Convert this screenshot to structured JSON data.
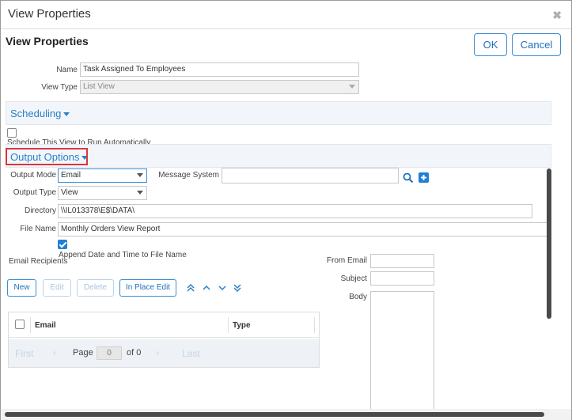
{
  "window": {
    "title": "View Properties",
    "close_glyph": "✖"
  },
  "heading": "View Properties",
  "buttons": {
    "ok": "OK",
    "cancel": "Cancel"
  },
  "fields": {
    "name": {
      "label": "Name",
      "value": "Task Assigned To Employees"
    },
    "view_type": {
      "label": "View Type",
      "value": "List View"
    }
  },
  "scheduling": {
    "title": "Scheduling",
    "checkbox_label": "Schedule This View to Run Automatically"
  },
  "output": {
    "title": "Output Options",
    "output_mode": {
      "label": "Output Mode",
      "value": "Email"
    },
    "message_system": {
      "label": "Message System",
      "value": ""
    },
    "output_type": {
      "label": "Output Type",
      "value": "View"
    },
    "directory": {
      "label": "Directory",
      "value": "\\\\IL013378\\E$\\DATA\\"
    },
    "file_name": {
      "label": "File Name",
      "value": "Monthly  Orders View Report"
    },
    "append_label": "Append Date and Time to File Name",
    "email_recipients": "Email Recipients",
    "from_email": {
      "label": "From Email",
      "value": ""
    },
    "subject": {
      "label": "Subject",
      "value": ""
    },
    "body": {
      "label": "Body",
      "value": ""
    }
  },
  "recipient_toolbar": {
    "new": "New",
    "edit": "Edit",
    "delete": "Delete",
    "in_place_edit": "In Place Edit"
  },
  "grid": {
    "columns": [
      "Email",
      "Type"
    ],
    "pager": {
      "first": "First",
      "page_label": "Page",
      "page_value": "0",
      "of_label": "of 0",
      "last": "Last"
    }
  },
  "icons": [
    "search-icon",
    "add-icon",
    "move-top-icon",
    "move-up-icon",
    "move-down-icon",
    "move-bottom-icon",
    "close-icon"
  ],
  "colors": {
    "accent": "#2a7fc8",
    "highlight_box": "#d9363e",
    "checkbox_checked": "#1e7fd6"
  }
}
